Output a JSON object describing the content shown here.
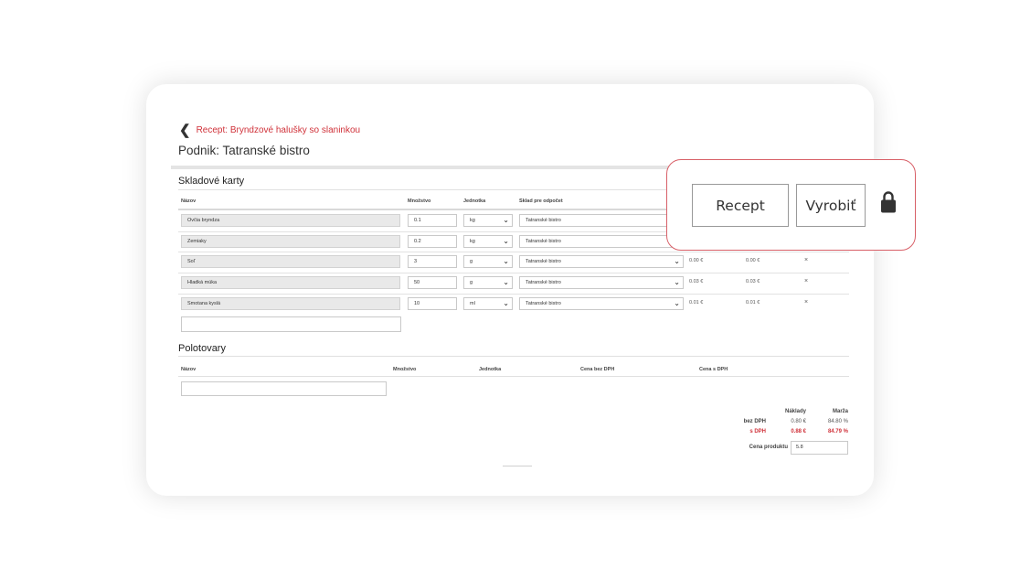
{
  "header": {
    "back_label": "Recept: Bryndzové halušky so slaninkou",
    "company": "Podnik: Tatranské bistro"
  },
  "stock": {
    "title": "Skladové karty",
    "columns": [
      "Názov",
      "Množstvo",
      "Jednotka",
      "Sklad pre odpočet"
    ],
    "rows": [
      {
        "name": "Ovčia bryndza",
        "qty": "0.1",
        "unit": "kg",
        "store": "Tatranské bistro",
        "price1": "",
        "price2": ""
      },
      {
        "name": "Zemiaky",
        "qty": "0.2",
        "unit": "kg",
        "store": "Tatranské bistro",
        "price1": "",
        "price2": ""
      },
      {
        "name": "Soľ",
        "qty": "3",
        "unit": "g",
        "store": "Tatranské bistro",
        "price1": "0.00 €",
        "price2": "0.00 €"
      },
      {
        "name": "Hladká múka",
        "qty": "50",
        "unit": "g",
        "store": "Tatranské bistro",
        "price1": "0.03 €",
        "price2": "0.03 €"
      },
      {
        "name": "Smotana kyslá",
        "qty": "10",
        "unit": "ml",
        "store": "Tatranské bistro",
        "price1": "0.01 €",
        "price2": "0.01 €"
      }
    ],
    "delete_glyph": "×"
  },
  "semi": {
    "title": "Polotovary",
    "columns": [
      "Názov",
      "Množstvo",
      "Jednotka",
      "Cena bez DPH",
      "Cena s DPH"
    ]
  },
  "summary": {
    "col_costs": "Náklady",
    "col_margin": "Marža",
    "row_net_label": "bez DPH",
    "row_net_cost": "0.80 €",
    "row_net_margin": "84.80 %",
    "row_gross_label": "s DPH",
    "row_gross_cost": "0.88 €",
    "row_gross_margin": "84.79 %",
    "product_price_label": "Cena produktu",
    "product_price_value": "5.8"
  },
  "popup": {
    "recipe_button": "Recept",
    "produce_button": "Vyrobiť",
    "lock_icon": "lock-icon"
  },
  "colors": {
    "accent": "#d0323a"
  }
}
